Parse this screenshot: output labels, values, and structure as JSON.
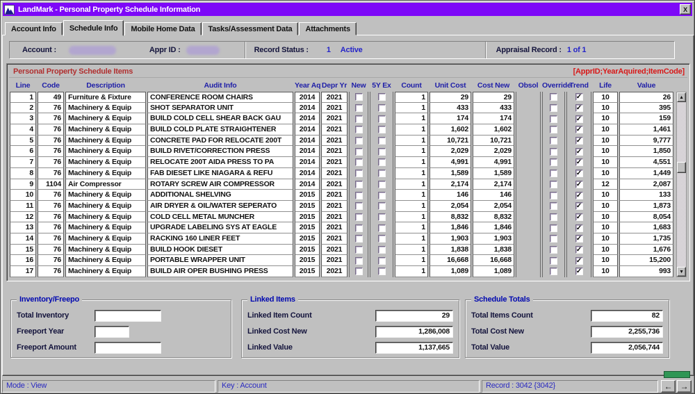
{
  "window": {
    "title": "LandMark - Personal Property Schedule Information",
    "close": "X"
  },
  "tabs": [
    {
      "label": "Account Info",
      "active": false
    },
    {
      "label": "Schedule Info",
      "active": true
    },
    {
      "label": "Mobile Home Data",
      "active": false
    },
    {
      "label": "Tasks/Assessment Data",
      "active": false
    },
    {
      "label": "Attachments",
      "active": false
    }
  ],
  "account_bar": {
    "account_label": "Account :",
    "appr_id_label": "Appr ID :",
    "record_status_label": "Record Status :",
    "record_status_number": "1",
    "record_status_text": "Active",
    "appraisal_record_label": "Appraisal Record :",
    "appraisal_record_value": "1 of 1"
  },
  "grid": {
    "title": "Personal Property Schedule Items",
    "key_hint": "[ApprID;YearAquired;ItemCode]",
    "columns": [
      "Line",
      "Code",
      "Description",
      "Audit Info",
      "Year Aq",
      "Depr Yr",
      "New",
      "5Y Ex",
      "Count",
      "Unit Cost",
      "Cost New",
      "Obsol",
      "Override",
      "Trend",
      "Life",
      "Value"
    ],
    "rows": [
      {
        "line": "1",
        "code": "49",
        "description": "Furniture & Fixture",
        "audit": "CONFERENCE ROOM CHAIRS",
        "year_aq": "2014",
        "depr_yr": "2021",
        "new": false,
        "five_y_ex": false,
        "count": "1",
        "unit_cost": "29",
        "cost_new": "29",
        "obsol": "",
        "override": false,
        "trend": true,
        "life": "10",
        "value": "26"
      },
      {
        "line": "2",
        "code": "76",
        "description": "Machinery & Equip",
        "audit": "SHOT SEPARATOR UNIT",
        "year_aq": "2014",
        "depr_yr": "2021",
        "new": false,
        "five_y_ex": false,
        "count": "1",
        "unit_cost": "433",
        "cost_new": "433",
        "obsol": "",
        "override": false,
        "trend": true,
        "life": "10",
        "value": "395"
      },
      {
        "line": "3",
        "code": "76",
        "description": "Machinery & Equip",
        "audit": "BUILD COLD CELL SHEAR BACK GAU",
        "year_aq": "2014",
        "depr_yr": "2021",
        "new": false,
        "five_y_ex": false,
        "count": "1",
        "unit_cost": "174",
        "cost_new": "174",
        "obsol": "",
        "override": false,
        "trend": true,
        "life": "10",
        "value": "159"
      },
      {
        "line": "4",
        "code": "76",
        "description": "Machinery & Equip",
        "audit": "BUILD COLD PLATE STRAIGHTENER",
        "year_aq": "2014",
        "depr_yr": "2021",
        "new": false,
        "five_y_ex": false,
        "count": "1",
        "unit_cost": "1,602",
        "cost_new": "1,602",
        "obsol": "",
        "override": false,
        "trend": true,
        "life": "10",
        "value": "1,461"
      },
      {
        "line": "5",
        "code": "76",
        "description": "Machinery & Equip",
        "audit": "CONCRETE PAD FOR RELOCATE 200T",
        "year_aq": "2014",
        "depr_yr": "2021",
        "new": false,
        "five_y_ex": false,
        "count": "1",
        "unit_cost": "10,721",
        "cost_new": "10,721",
        "obsol": "",
        "override": false,
        "trend": true,
        "life": "10",
        "value": "9,777"
      },
      {
        "line": "6",
        "code": "76",
        "description": "Machinery & Equip",
        "audit": "BUILD RIVET/CORRECTION PRESS",
        "year_aq": "2014",
        "depr_yr": "2021",
        "new": false,
        "five_y_ex": false,
        "count": "1",
        "unit_cost": "2,029",
        "cost_new": "2,029",
        "obsol": "",
        "override": false,
        "trend": true,
        "life": "10",
        "value": "1,850"
      },
      {
        "line": "7",
        "code": "76",
        "description": "Machinery & Equip",
        "audit": "RELOCATE 200T AIDA PRESS TO PA",
        "year_aq": "2014",
        "depr_yr": "2021",
        "new": false,
        "five_y_ex": false,
        "count": "1",
        "unit_cost": "4,991",
        "cost_new": "4,991",
        "obsol": "",
        "override": false,
        "trend": true,
        "life": "10",
        "value": "4,551"
      },
      {
        "line": "8",
        "code": "76",
        "description": "Machinery & Equip",
        "audit": "FAB DIESET LIKE NIAGARA & REFU",
        "year_aq": "2014",
        "depr_yr": "2021",
        "new": false,
        "five_y_ex": false,
        "count": "1",
        "unit_cost": "1,589",
        "cost_new": "1,589",
        "obsol": "",
        "override": false,
        "trend": true,
        "life": "10",
        "value": "1,449"
      },
      {
        "line": "9",
        "code": "1104",
        "description": "Air Compressor",
        "audit": "ROTARY SCREW AIR COMPRESSOR",
        "year_aq": "2014",
        "depr_yr": "2021",
        "new": false,
        "five_y_ex": false,
        "count": "1",
        "unit_cost": "2,174",
        "cost_new": "2,174",
        "obsol": "",
        "override": false,
        "trend": true,
        "life": "12",
        "value": "2,087"
      },
      {
        "line": "10",
        "code": "76",
        "description": "Machinery & Equip",
        "audit": "ADDITIONAL SHELVING",
        "year_aq": "2015",
        "depr_yr": "2021",
        "new": false,
        "five_y_ex": false,
        "count": "1",
        "unit_cost": "146",
        "cost_new": "146",
        "obsol": "",
        "override": false,
        "trend": true,
        "life": "10",
        "value": "133"
      },
      {
        "line": "11",
        "code": "76",
        "description": "Machinery & Equip",
        "audit": "AIR DRYER & OIL/WATER SEPERATO",
        "year_aq": "2015",
        "depr_yr": "2021",
        "new": false,
        "five_y_ex": false,
        "count": "1",
        "unit_cost": "2,054",
        "cost_new": "2,054",
        "obsol": "",
        "override": false,
        "trend": true,
        "life": "10",
        "value": "1,873"
      },
      {
        "line": "12",
        "code": "76",
        "description": "Machinery & Equip",
        "audit": "COLD CELL METAL MUNCHER",
        "year_aq": "2015",
        "depr_yr": "2021",
        "new": false,
        "five_y_ex": false,
        "count": "1",
        "unit_cost": "8,832",
        "cost_new": "8,832",
        "obsol": "",
        "override": false,
        "trend": true,
        "life": "10",
        "value": "8,054"
      },
      {
        "line": "13",
        "code": "76",
        "description": "Machinery & Equip",
        "audit": "UPGRADE LABELING SYS AT EAGLE",
        "year_aq": "2015",
        "depr_yr": "2021",
        "new": false,
        "five_y_ex": false,
        "count": "1",
        "unit_cost": "1,846",
        "cost_new": "1,846",
        "obsol": "",
        "override": false,
        "trend": true,
        "life": "10",
        "value": "1,683"
      },
      {
        "line": "14",
        "code": "76",
        "description": "Machinery & Equip",
        "audit": "RACKING 160 LINER FEET",
        "year_aq": "2015",
        "depr_yr": "2021",
        "new": false,
        "five_y_ex": false,
        "count": "1",
        "unit_cost": "1,903",
        "cost_new": "1,903",
        "obsol": "",
        "override": false,
        "trend": true,
        "life": "10",
        "value": "1,735"
      },
      {
        "line": "15",
        "code": "76",
        "description": "Machinery & Equip",
        "audit": "BUILD HOOK DIESET",
        "year_aq": "2015",
        "depr_yr": "2021",
        "new": false,
        "five_y_ex": false,
        "count": "1",
        "unit_cost": "1,838",
        "cost_new": "1,838",
        "obsol": "",
        "override": false,
        "trend": true,
        "life": "10",
        "value": "1,676"
      },
      {
        "line": "16",
        "code": "76",
        "description": "Machinery & Equip",
        "audit": "PORTABLE WRAPPER UNIT",
        "year_aq": "2015",
        "depr_yr": "2021",
        "new": false,
        "five_y_ex": false,
        "count": "1",
        "unit_cost": "16,668",
        "cost_new": "16,668",
        "obsol": "",
        "override": false,
        "trend": true,
        "life": "10",
        "value": "15,200"
      },
      {
        "line": "17",
        "code": "76",
        "description": "Machinery & Equip",
        "audit": "BUILD AIR OPER BUSHING PRESS",
        "year_aq": "2015",
        "depr_yr": "2021",
        "new": false,
        "five_y_ex": false,
        "count": "1",
        "unit_cost": "1,089",
        "cost_new": "1,089",
        "obsol": "",
        "override": false,
        "trend": true,
        "life": "10",
        "value": "993"
      }
    ]
  },
  "panels": {
    "inventory": {
      "title": "Inventory/Freepo",
      "fields": [
        {
          "label": "Total Inventory",
          "value": ""
        },
        {
          "label": "Freeport Year",
          "value": ""
        },
        {
          "label": "Freeport Amount",
          "value": ""
        }
      ]
    },
    "linked": {
      "title": "Linked Items",
      "fields": [
        {
          "label": "Linked Item Count",
          "value": "29"
        },
        {
          "label": "Linked Cost New",
          "value": "1,286,008"
        },
        {
          "label": "Linked Value",
          "value": "1,137,665"
        }
      ]
    },
    "totals": {
      "title": "Schedule Totals",
      "fields": [
        {
          "label": "Total Items Count",
          "value": "82"
        },
        {
          "label": "Total Cost New",
          "value": "2,255,736"
        },
        {
          "label": "Total Value",
          "value": "2,056,744"
        }
      ]
    }
  },
  "status_bar": {
    "mode": "Mode : View",
    "key": "Key : Account",
    "record": "Record : 3042 {3042}",
    "prev_arrow": "←",
    "next_arrow": "→"
  },
  "colors": {
    "titlebar": "#7d08f8",
    "header_blue": "#1f1fa8",
    "value_blue": "#2424c8",
    "red_title": "#b03030",
    "red_hint": "#d81818",
    "green_indicator": "#2f9655"
  }
}
